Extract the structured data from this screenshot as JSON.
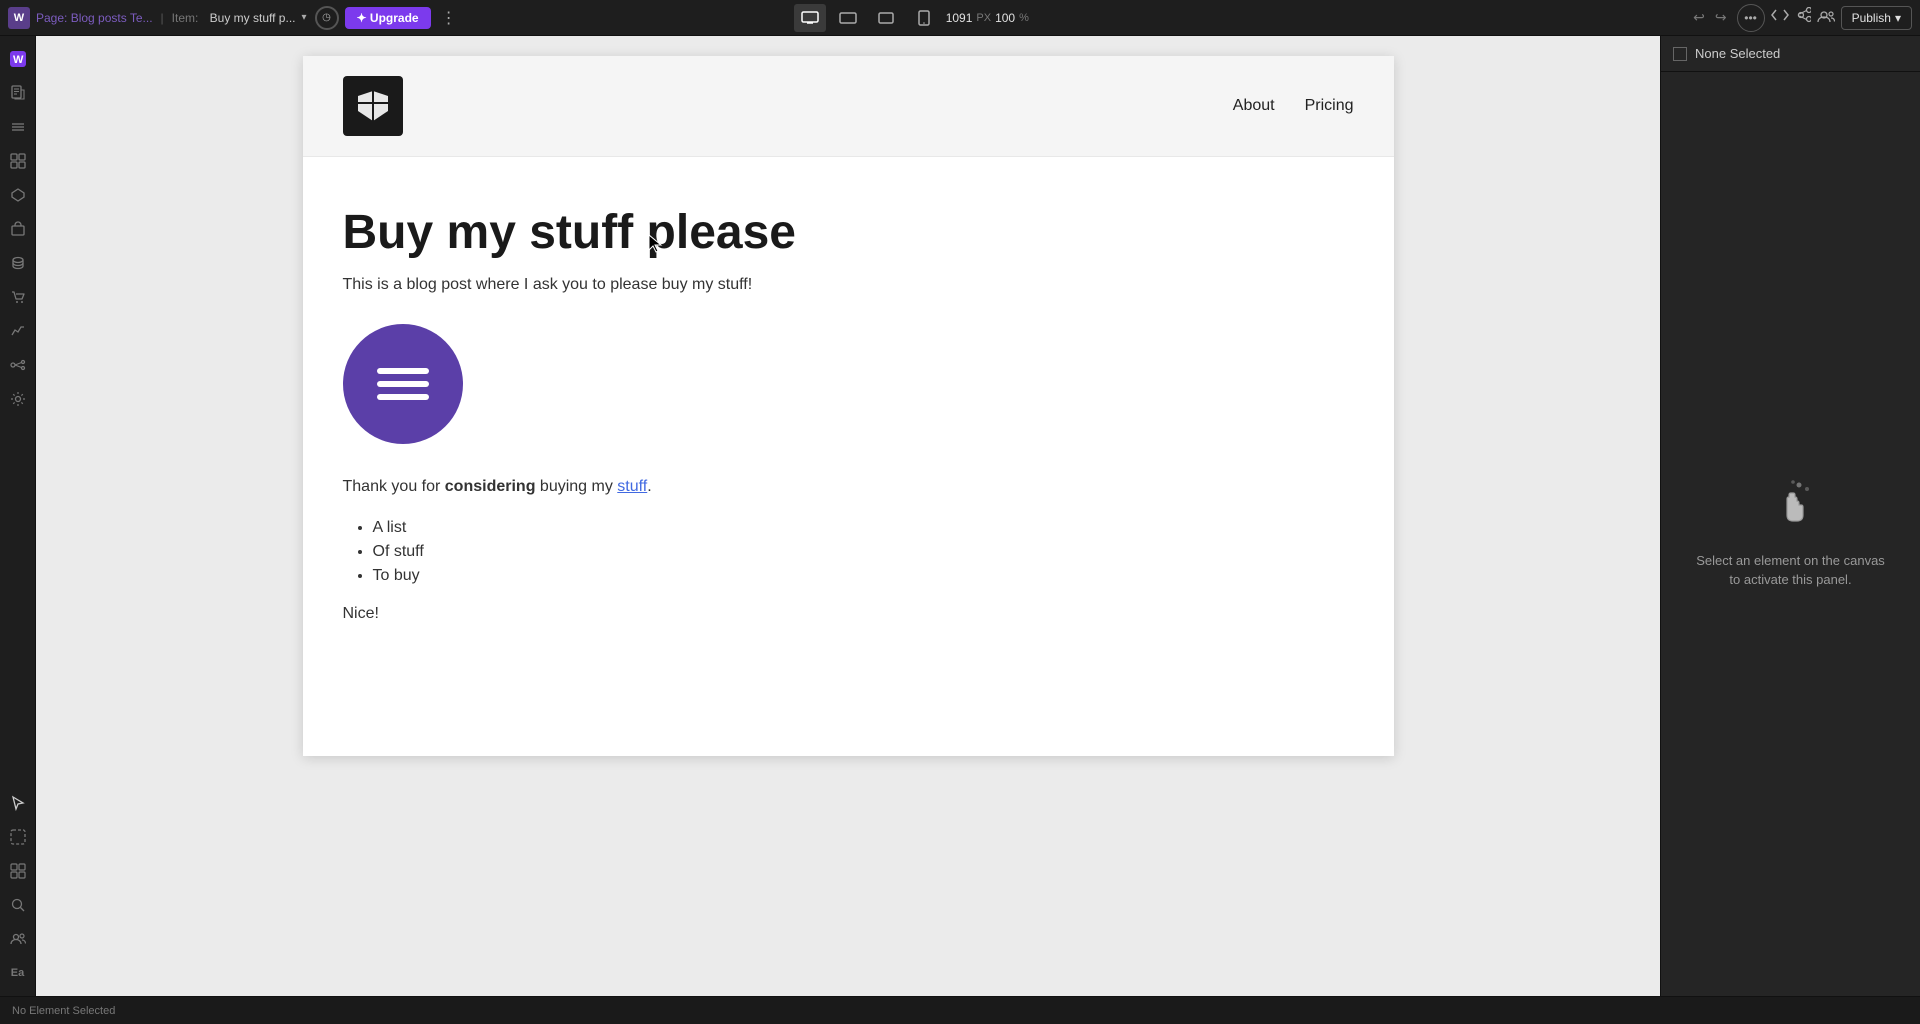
{
  "topbar": {
    "logo_text": "W",
    "breadcrumb_page_label": "Page:",
    "breadcrumb_page_value": "Blog posts Te...",
    "breadcrumb_item_label": "Item:",
    "breadcrumb_item_value": "Buy my stuff p...",
    "upgrade_label": "✦ Upgrade",
    "more_label": "⋮",
    "width_value": "1091",
    "width_unit": "PX",
    "zoom_value": "100",
    "zoom_unit": "%",
    "publish_label": "Publish"
  },
  "left_sidebar": {
    "icons": [
      {
        "name": "webflow-logo",
        "symbol": "W",
        "active": true
      },
      {
        "name": "pages-icon",
        "symbol": "⊞"
      },
      {
        "name": "layers-icon",
        "symbol": "≡"
      },
      {
        "name": "add-icon",
        "symbol": "+"
      },
      {
        "name": "components-icon",
        "symbol": "◫"
      },
      {
        "name": "assets-icon",
        "symbol": "▦"
      },
      {
        "name": "cms-icon",
        "symbol": "⊟"
      },
      {
        "name": "ecommerce-icon",
        "symbol": "🛒"
      },
      {
        "name": "interactions-icon",
        "symbol": "⚡"
      },
      {
        "name": "logic-icon",
        "symbol": "⊹"
      },
      {
        "name": "settings-icon",
        "symbol": "⚙"
      }
    ],
    "bottom_icons": [
      {
        "name": "select-tool",
        "symbol": "↖",
        "active": true
      },
      {
        "name": "component-tool",
        "symbol": "⊡"
      },
      {
        "name": "grid-tool",
        "symbol": "⊞"
      },
      {
        "name": "search-icon",
        "symbol": "🔍"
      },
      {
        "name": "users-icon",
        "symbol": "👥"
      },
      {
        "name": "ea-label",
        "text": "Ea"
      }
    ]
  },
  "site": {
    "nav": {
      "about_label": "About",
      "pricing_label": "Pricing"
    },
    "blog_post": {
      "title": "Buy my stuff please",
      "subtitle": "This is a blog post where I ask you to please buy my stuff!",
      "body_text_prefix": "Thank you for ",
      "body_text_bold": "considering",
      "body_text_middle": " buying my ",
      "body_text_link": "stuff",
      "body_text_suffix": ".",
      "list_items": [
        "A list",
        "Of stuff",
        "To buy"
      ],
      "closing": "Nice!"
    }
  },
  "right_panel": {
    "none_selected_label": "None Selected",
    "hint_line1": "Select an element on the canvas",
    "hint_line2": "to activate this panel."
  },
  "status_bar": {
    "message": "No Element Selected"
  },
  "bottom_left": {
    "label": "Ea"
  }
}
